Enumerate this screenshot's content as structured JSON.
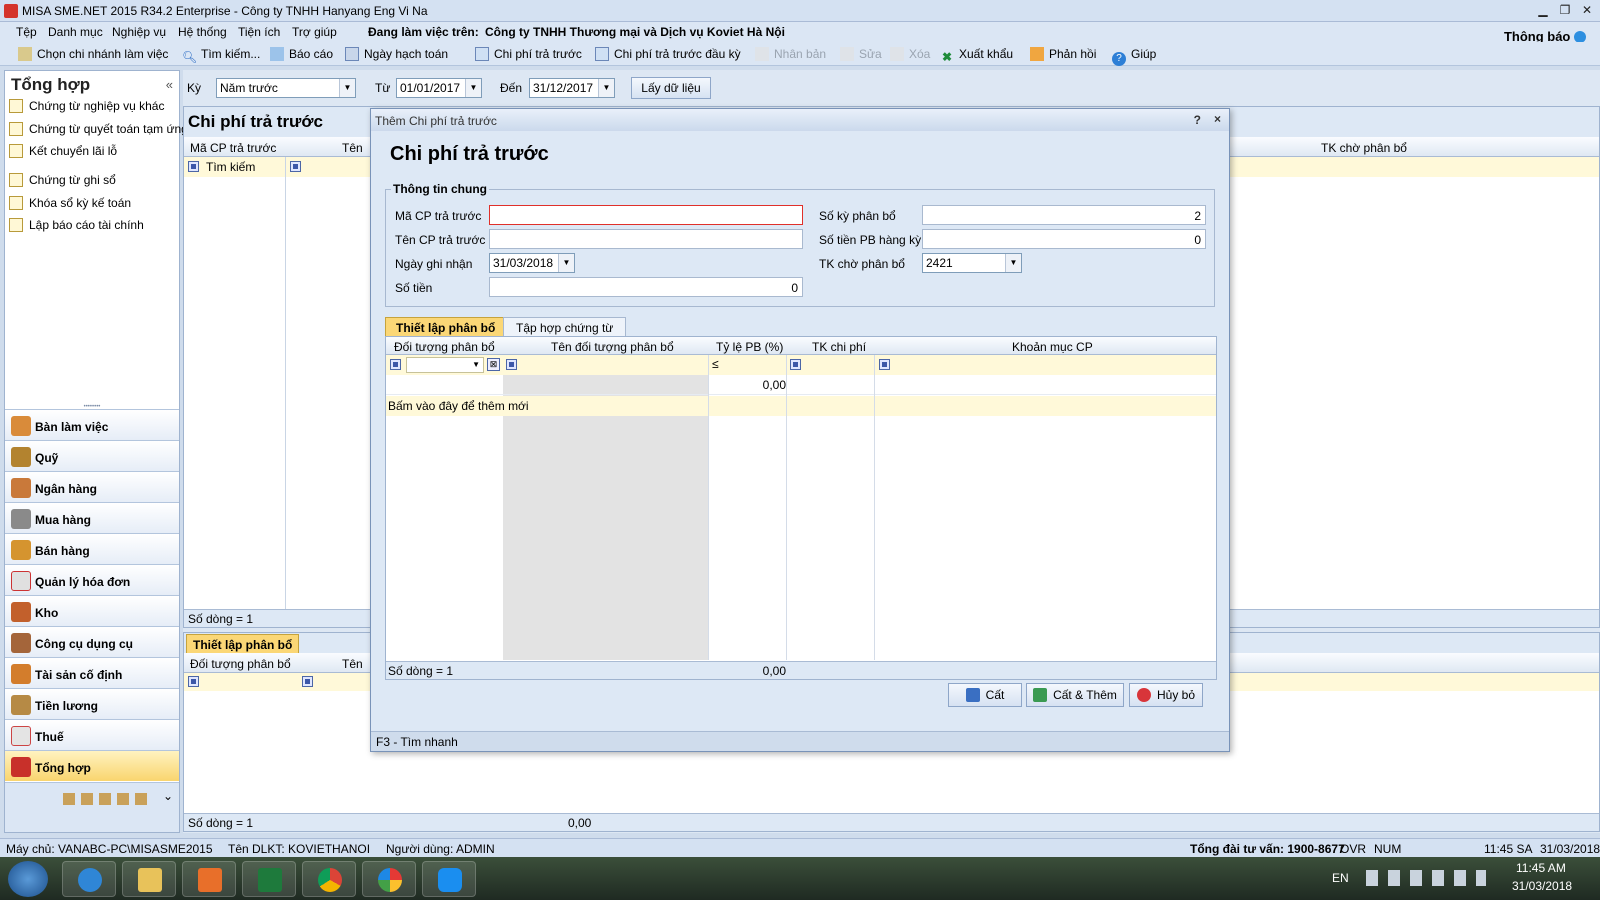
{
  "window": {
    "title": "MISA SME.NET 2015 R34.2 Enterprise - Công ty TNHH Hanyang Eng Vi Na"
  },
  "menu": [
    "Tệp",
    "Danh mục",
    "Nghiệp vụ",
    "Hệ thống",
    "Tiện ích",
    "Trợ giúp"
  ],
  "workspace": {
    "label": "Đang làm việc trên:",
    "company": "Công ty TNHH Thương mại và Dịch vụ Koviet Hà Nội"
  },
  "notification": "Thông báo",
  "toolbar": {
    "branch": "Chọn chi nhánh làm việc",
    "search": "Tìm kiếm...",
    "report": "Báo cáo",
    "posting_date": "Ngày hạch toán",
    "prepaid": "Chi phí trả trước",
    "prepaid_opening": "Chi phí trả trước đầu kỳ",
    "duplicate": "Nhân bản",
    "edit": "Sửa",
    "delete": "Xóa",
    "export": "Xuất khẩu",
    "feedback": "Phản hồi",
    "help": "Giúp"
  },
  "sidebar": {
    "title": "Tổng hợp",
    "items": [
      "Chứng từ nghiệp vụ khác",
      "Chứng từ quyết toán tạm ứng",
      "Kết chuyển lãi lỗ",
      "Chứng từ ghi sổ",
      "Khóa sổ kỳ kế toán",
      "Lập báo cáo tài chính"
    ],
    "modules": [
      "Bàn làm việc",
      "Quỹ",
      "Ngân hàng",
      "Mua hàng",
      "Bán hàng",
      "Quản lý hóa đơn",
      "Kho",
      "Công cụ dụng cụ",
      "Tài sản cố định",
      "Tiền lương",
      "Thuế",
      "Tổng hợp"
    ]
  },
  "filter": {
    "period_label": "Kỳ",
    "period_value": "Năm trước",
    "from_label": "Từ",
    "from_value": "01/01/2017",
    "to_label": "Đến",
    "to_value": "31/12/2017",
    "fetch_button": "Lấy dữ liệu"
  },
  "main": {
    "title": "Chi phí trả trước",
    "col_code": "Mã CP trả trước",
    "col_name": "Tên",
    "col_tk": "TK chờ phân bổ",
    "search_text": "Tìm kiếm",
    "row_count": "Số dòng = 1",
    "tab_alloc": "Thiết lập phân bổ",
    "bottom_col_obj": "Đối tượng phân bổ",
    "bottom_col_name": "Tên",
    "bottom_row_count": "Số dòng = 1",
    "bottom_total": "0,00"
  },
  "dialog": {
    "window_title": "Thêm Chi phí trả trước",
    "help": "?",
    "close": "×",
    "heading": "Chi phí trả trước",
    "group": "Thông tin chung",
    "code_label": "Mã CP trả trước",
    "code_value": "",
    "name_label": "Tên CP trả trước",
    "name_value": "",
    "date_label": "Ngày ghi nhận",
    "date_value": "31/03/2018",
    "amount_label": "Số tiền",
    "amount_value": "0",
    "periods_label": "Số kỳ phân bổ",
    "periods_value": "2",
    "per_period_label": "Số tiền PB hàng kỳ",
    "per_period_value": "0",
    "account_label": "TK chờ phân bổ",
    "account_value": "2421",
    "tabs": [
      "Thiết lập phân bổ",
      "Tập hợp chứng từ"
    ],
    "grid": {
      "cols": [
        "Đối tượng phân bổ",
        "Tên đối tượng phân bổ",
        "Tỷ lệ PB (%)",
        "TK chi phí",
        "Khoản mục CP"
      ],
      "le_sign": "≤",
      "row_pct": "0,00",
      "add_hint": "Bấm vào đây để thêm mới",
      "row_count": "Số dòng = 1",
      "total_pct": "0,00"
    },
    "buttons": {
      "save": "Cất",
      "save_add": "Cất & Thêm",
      "cancel": "Hủy bỏ"
    },
    "footer": "F3 - Tìm nhanh"
  },
  "status": {
    "server": "Máy chủ: VANABC-PC\\MISASME2015",
    "dlkt": "Tên DLKT: KOVIETHANOI",
    "user": "Người dùng: ADMIN",
    "hotline": "Tổng đài tư vấn: 1900-8677",
    "ovr": "OVR",
    "num": "NUM",
    "time": "11:45 SA",
    "date": "31/03/2018"
  },
  "taskbar": {
    "lang": "EN",
    "time": "11:45 AM",
    "date": "31/03/2018"
  }
}
